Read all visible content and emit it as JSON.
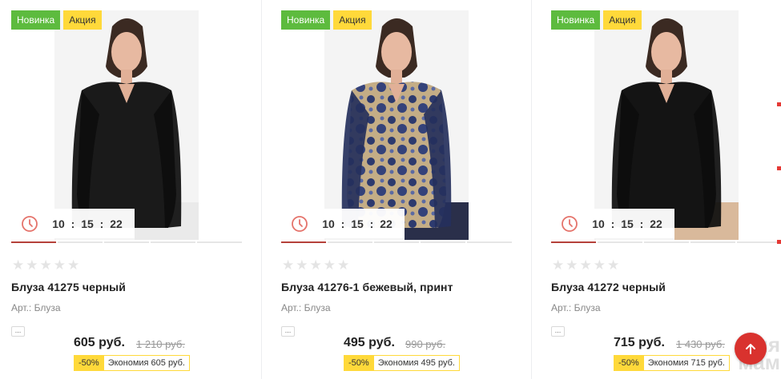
{
  "products": [
    {
      "badges": {
        "new": "Новинка",
        "sale": "Акция"
      },
      "timer": {
        "hours": "10",
        "minutes": "15",
        "seconds": "22",
        "sep": ":"
      },
      "title": "Блуза 41275 черный",
      "article": "Арт.: Блуза",
      "more": "...",
      "price": "605 руб.",
      "old_price": "1 210 руб.",
      "discount_percent": "-50%",
      "savings": "Экономия 605 руб.",
      "blouse_color": "#1a1a1a"
    },
    {
      "badges": {
        "new": "Новинка",
        "sale": "Акция"
      },
      "timer": {
        "hours": "10",
        "minutes": "15",
        "seconds": "22",
        "sep": ":"
      },
      "title": "Блуза 41276-1 бежевый, принт",
      "article": "Арт.: Блуза",
      "more": "...",
      "price": "495 руб.",
      "old_price": "990 руб.",
      "discount_percent": "-50%",
      "savings": "Экономия 495 руб.",
      "blouse_color": "#c4ad86"
    },
    {
      "badges": {
        "new": "Новинка",
        "sale": "Акция"
      },
      "timer": {
        "hours": "10",
        "minutes": "15",
        "seconds": "22",
        "sep": ":"
      },
      "title": "Блуза 41272 черный",
      "article": "Арт.: Блуза",
      "more": "...",
      "price": "715 руб.",
      "old_price": "1 430 руб.",
      "discount_percent": "-50%",
      "savings": "Экономия 715 руб.",
      "blouse_color": "#141414"
    }
  ],
  "watermark": "для мам",
  "colors": {
    "badge_new": "#5dbb3e",
    "badge_sale": "#ffd93a",
    "accent_red": "#d9322e",
    "timer_icon": "#e5736b"
  },
  "icons": {
    "timer": "clock-icon",
    "scroll_top": "arrow-up-icon",
    "rating": "star-icon"
  }
}
